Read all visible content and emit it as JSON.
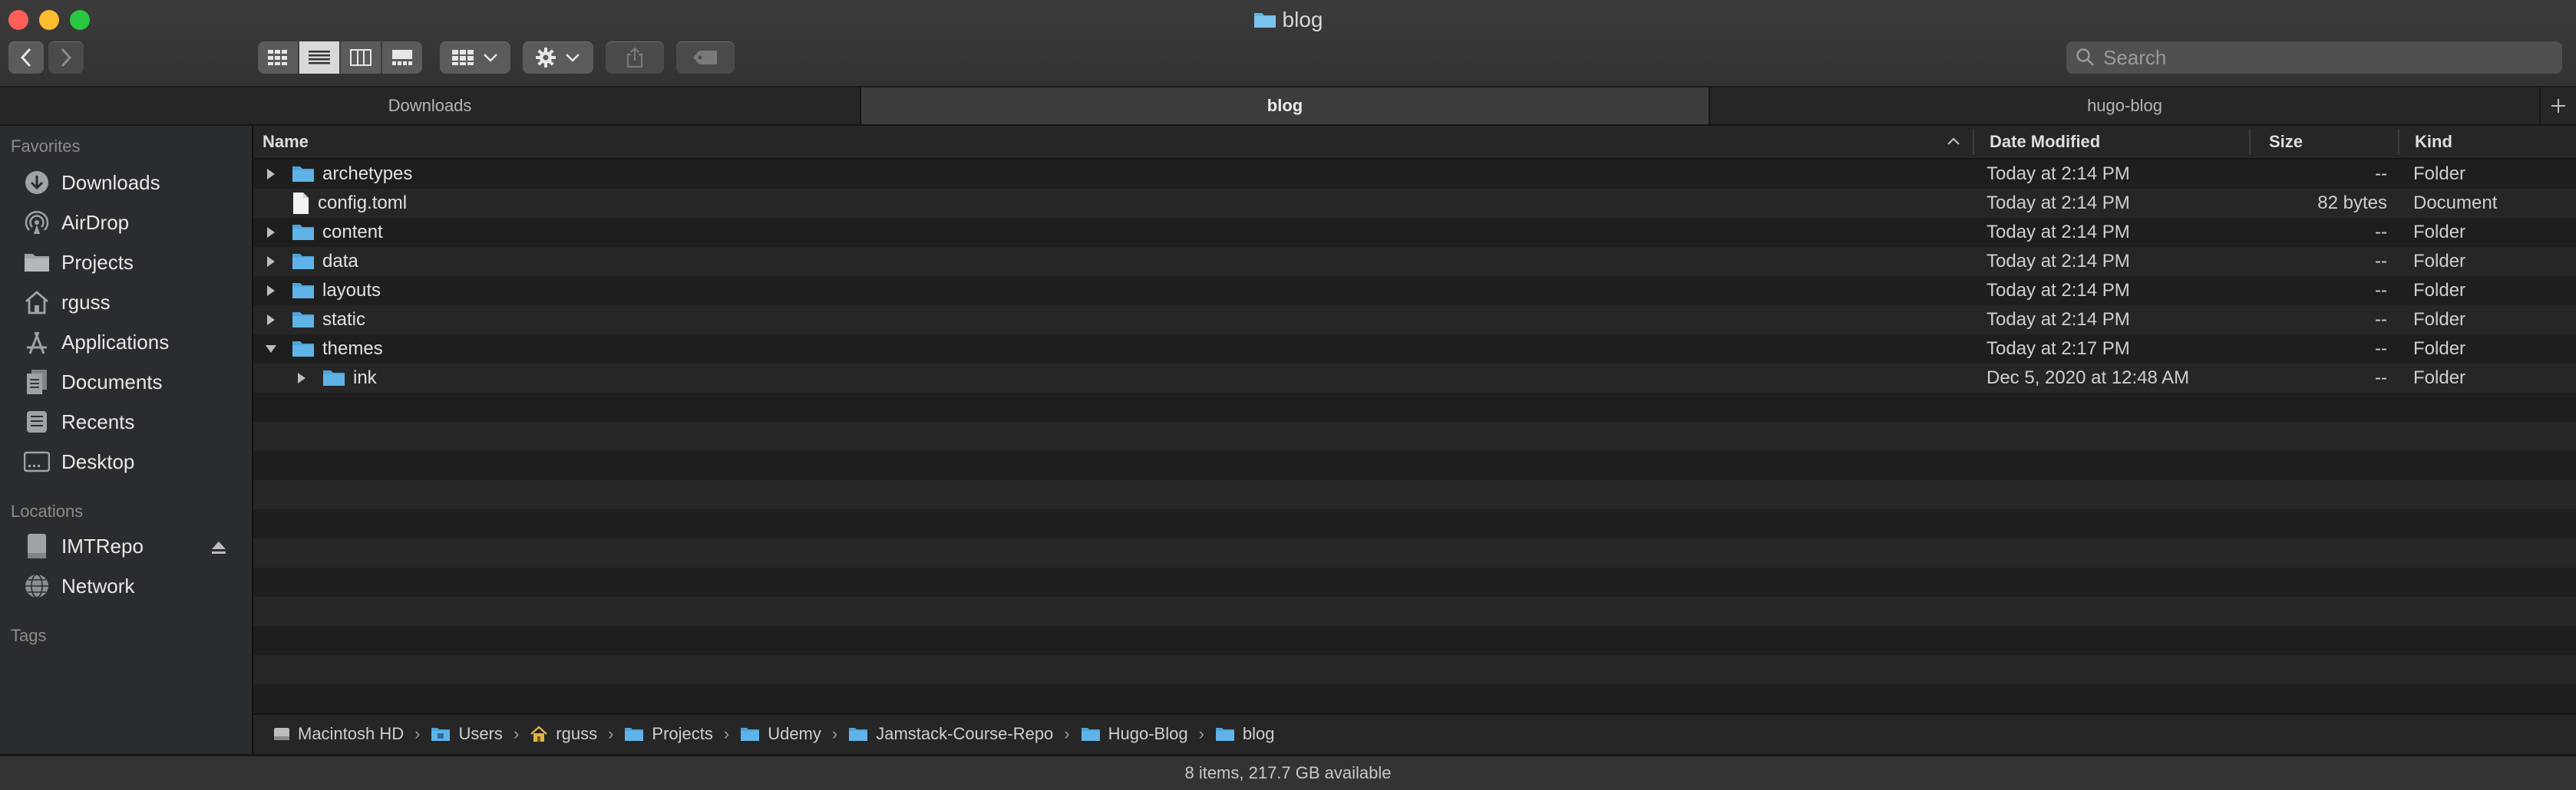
{
  "window": {
    "title": "blog"
  },
  "search": {
    "placeholder": "Search"
  },
  "tabs": [
    {
      "label": "Downloads"
    },
    {
      "label": "blog"
    },
    {
      "label": "hugo-blog"
    }
  ],
  "sidebar": {
    "favorites_header": "Favorites",
    "favorites": [
      {
        "label": "Downloads",
        "icon": "downloads-icon"
      },
      {
        "label": "AirDrop",
        "icon": "airdrop-icon"
      },
      {
        "label": "Projects",
        "icon": "folder-icon"
      },
      {
        "label": "rguss",
        "icon": "home-icon"
      },
      {
        "label": "Applications",
        "icon": "applications-icon"
      },
      {
        "label": "Documents",
        "icon": "documents-icon"
      },
      {
        "label": "Recents",
        "icon": "recents-icon"
      },
      {
        "label": "Desktop",
        "icon": "desktop-icon"
      }
    ],
    "locations_header": "Locations",
    "locations": [
      {
        "label": "IMTRepo",
        "icon": "drive-icon"
      },
      {
        "label": "Network",
        "icon": "network-icon"
      }
    ],
    "tags_header": "Tags"
  },
  "columns": {
    "name": "Name",
    "date": "Date Modified",
    "size": "Size",
    "kind": "Kind"
  },
  "files": [
    {
      "name": "archetypes",
      "date": "Today at 2:14 PM",
      "size": "--",
      "kind": "Folder",
      "type": "folder",
      "disclosure": "collapsed",
      "indent": 0
    },
    {
      "name": "config.toml",
      "date": "Today at 2:14 PM",
      "size": "82 bytes",
      "kind": "Document",
      "type": "file",
      "disclosure": "none",
      "indent": 0
    },
    {
      "name": "content",
      "date": "Today at 2:14 PM",
      "size": "--",
      "kind": "Folder",
      "type": "folder",
      "disclosure": "collapsed",
      "indent": 0
    },
    {
      "name": "data",
      "date": "Today at 2:14 PM",
      "size": "--",
      "kind": "Folder",
      "type": "folder",
      "disclosure": "collapsed",
      "indent": 0
    },
    {
      "name": "layouts",
      "date": "Today at 2:14 PM",
      "size": "--",
      "kind": "Folder",
      "type": "folder",
      "disclosure": "collapsed",
      "indent": 0
    },
    {
      "name": "static",
      "date": "Today at 2:14 PM",
      "size": "--",
      "kind": "Folder",
      "type": "folder",
      "disclosure": "collapsed",
      "indent": 0
    },
    {
      "name": "themes",
      "date": "Today at 2:17 PM",
      "size": "--",
      "kind": "Folder",
      "type": "folder",
      "disclosure": "expanded",
      "indent": 0
    },
    {
      "name": "ink",
      "date": "Dec 5, 2020 at 12:48 AM",
      "size": "--",
      "kind": "Folder",
      "type": "folder",
      "disclosure": "collapsed",
      "indent": 1
    }
  ],
  "path": [
    {
      "label": "Macintosh HD",
      "icon": "disk-icon"
    },
    {
      "label": "Users",
      "icon": "users-folder-icon"
    },
    {
      "label": "rguss",
      "icon": "home-icon"
    },
    {
      "label": "Projects",
      "icon": "folder-icon"
    },
    {
      "label": "Udemy",
      "icon": "folder-icon"
    },
    {
      "label": "Jamstack-Course-Repo",
      "icon": "folder-icon"
    },
    {
      "label": "Hugo-Blog",
      "icon": "folder-icon"
    },
    {
      "label": "blog",
      "icon": "folder-icon"
    }
  ],
  "status": {
    "text": "8 items, 217.7 GB available"
  },
  "colors": {
    "folder": "#5fb3e6",
    "accent": "#3a8ee6"
  }
}
